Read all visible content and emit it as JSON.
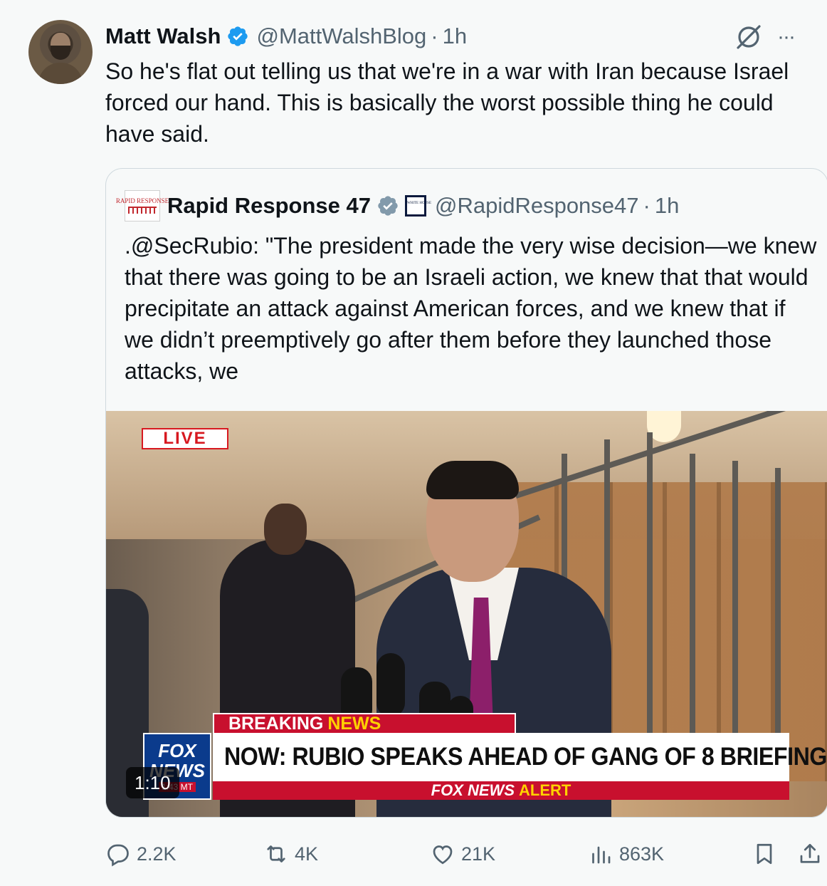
{
  "tweet": {
    "author_name": "Matt Walsh",
    "author_handle": "@MattWalshBlog",
    "separator": "·",
    "time": "1h",
    "more_label": "···",
    "text": "So he's flat out telling us that we're in a war with Iran because Israel forced our hand. This is basically the worst possible thing he could have said."
  },
  "quote": {
    "avatar_text": "RAPID RESPONSE",
    "author_name": "Rapid Response 47",
    "affiliate_badge_text": "WHITE HOUSE",
    "author_handle": "@RapidResponse47",
    "separator": "·",
    "time": "1h",
    "text": ".@SecRubio: \"The president made the very wise decision—we knew that there was going to be an Israeli action, we knew that that would precipitate an attack against American forces, and we knew that if we didn’t preemptively go after them before they launched those attacks, we",
    "video": {
      "live_label": "LIVE",
      "breaking_word1": "BREAKING",
      "breaking_word2": "NEWS",
      "headline": "NOW: RUBIO SPEAKS AHEAD OF GANG OF 8 BRIEFING",
      "alert_word1": "FOX NEWS",
      "alert_word2": "ALERT",
      "logo_line1": "FOX",
      "logo_line2": "NEWS",
      "logo_time": "1:43 MT",
      "duration": "1:10"
    }
  },
  "actions": {
    "replies": "2.2K",
    "reposts": "4K",
    "likes": "21K",
    "views": "863K"
  },
  "colors": {
    "verified_blue": "#1d9bf0",
    "affiliate_gray": "#829aab",
    "secondary_text": "#536471",
    "fox_red": "#c8102e",
    "fox_yellow": "#ffd200"
  }
}
